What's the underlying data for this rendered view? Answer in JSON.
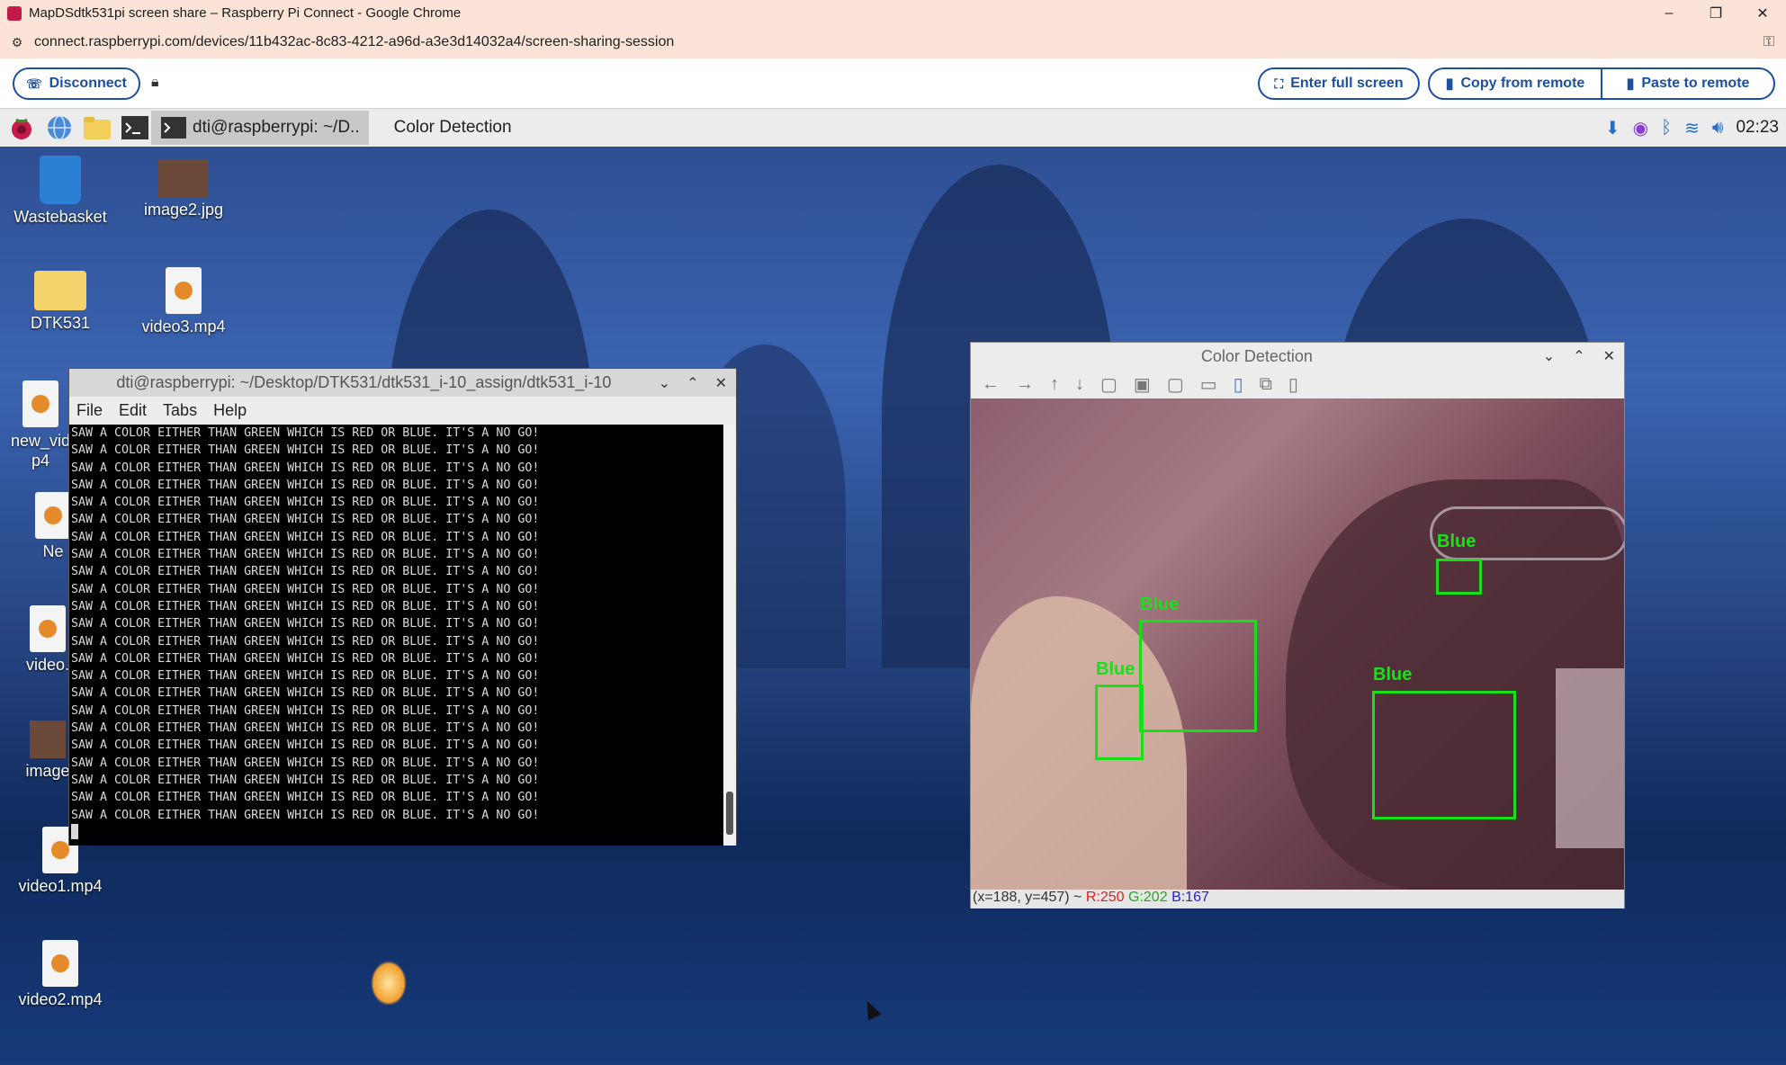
{
  "browser": {
    "title": "MapDSdtk531pi screen share – Raspberry Pi Connect - Google Chrome",
    "url": "connect.raspberrypi.com/devices/11b432ac-8c83-4212-a96d-a3e3d14032a4/screen-sharing-session",
    "minimize": "–",
    "maximize": "❐",
    "close": "✕"
  },
  "connect": {
    "disconnect_label": "Disconnect",
    "fullscreen_label": "Enter full screen",
    "copy_label": "Copy from remote",
    "paste_label": "Paste to remote"
  },
  "taskbar": {
    "task_terminal": "dti@raspberrypi: ~/D..",
    "task_color": "Color Detection",
    "clock": "02:23"
  },
  "desktop_icons": {
    "wastebasket": "Wastebasket",
    "image2": "image2.jpg",
    "dtk531": "DTK531",
    "video3": "video3.mp4",
    "new_video_a": "new_vid",
    "new_video_b": "p4",
    "new_file": "Ne",
    "video_partial": "video.",
    "image_partial": "image",
    "video1": "video1.mp4",
    "video2": "video2.mp4"
  },
  "terminal": {
    "title": "dti@raspberrypi: ~/Desktop/DTK531/dtk531_i-10_assign/dtk531_i-10",
    "menu": [
      "File",
      "Edit",
      "Tabs",
      "Help"
    ],
    "line": "SAW A COLOR EITHER THAN GREEN WHICH IS RED OR BLUE. IT'S A NO GO!",
    "line_count": 23
  },
  "color_window": {
    "title": "Color Detection",
    "labels": [
      "Blue",
      "Blue",
      "Blue",
      "Blue"
    ],
    "status_prefix": "(x=188, y=457) ~ ",
    "status_r": "R:250",
    "status_g": "G:202",
    "status_b": "B:167"
  },
  "colors": {
    "chrome_frame": "#fbe3d7",
    "accent": "#1c4fa0",
    "detection_box": "#18e018"
  }
}
